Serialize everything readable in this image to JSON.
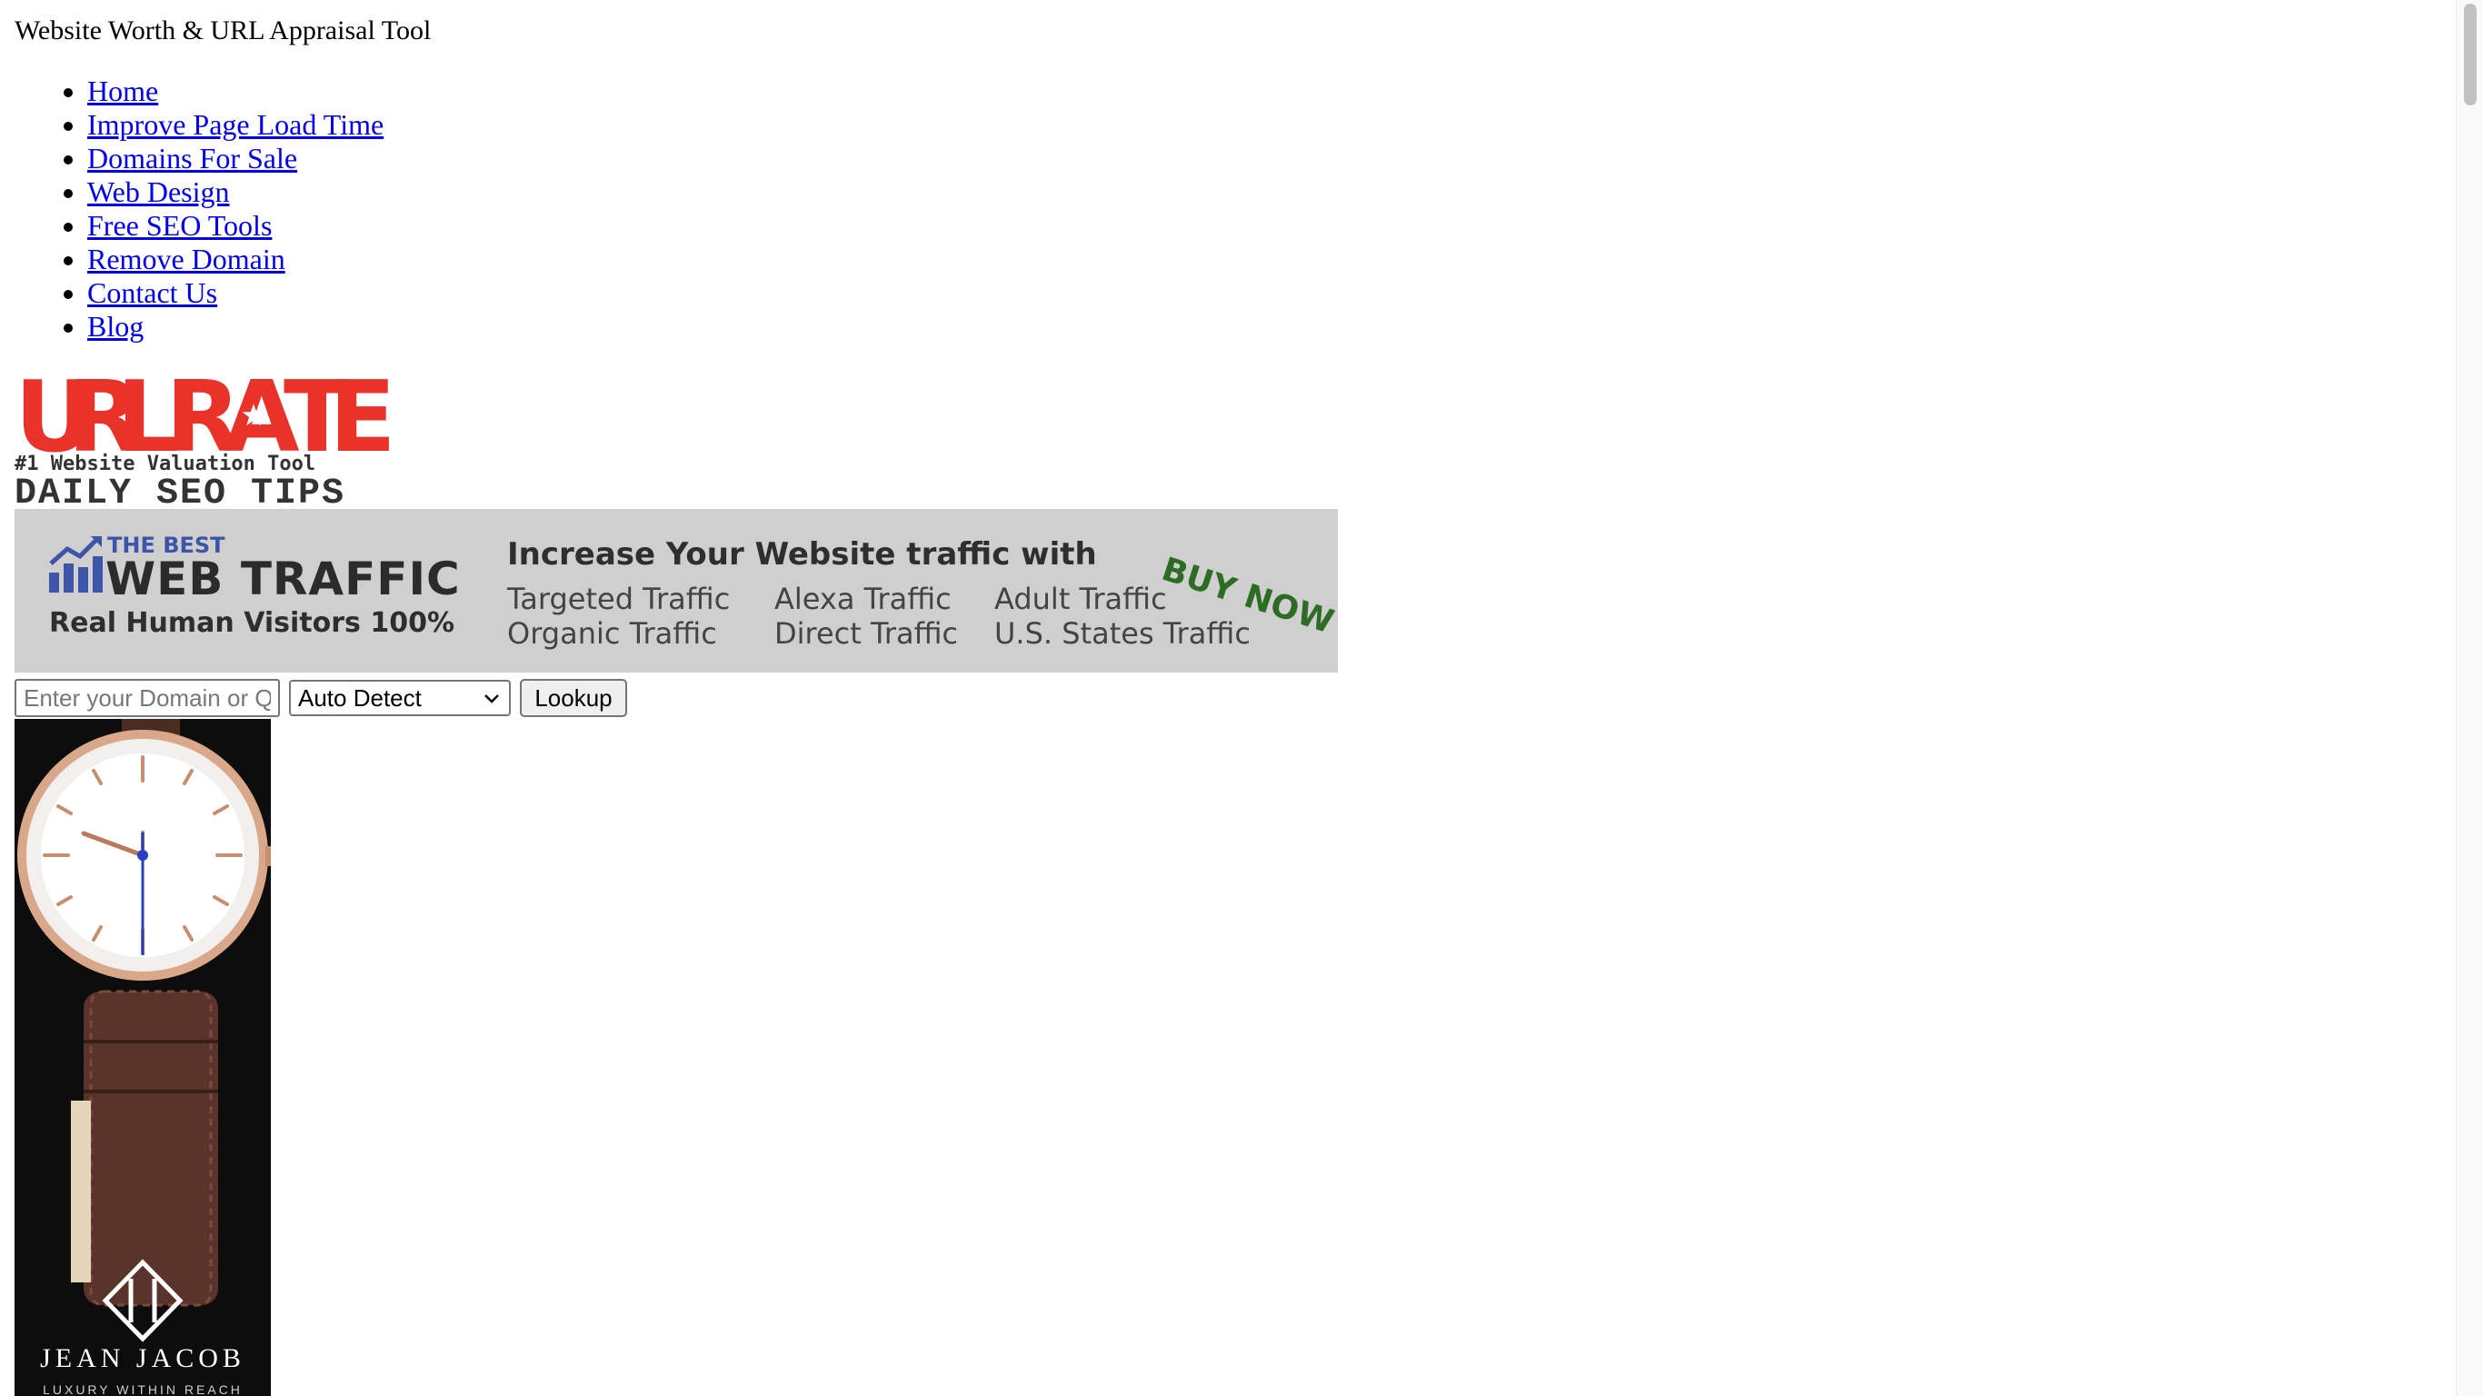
{
  "header": {
    "site_title": "Website Worth & URL Appraisal Tool"
  },
  "nav": [
    {
      "label": "Home"
    },
    {
      "label": "Improve Page Load Time"
    },
    {
      "label": "Domains For Sale"
    },
    {
      "label": "Web Design"
    },
    {
      "label": "Free SEO Tools"
    },
    {
      "label": "Remove Domain"
    },
    {
      "label": "Contact Us"
    },
    {
      "label": "Blog"
    }
  ],
  "logo": {
    "wordmark": "URLRATE",
    "tagline": "#1 Website Valuation Tool",
    "subtitle": "DAILY SEO TIPS",
    "color": "#e8322a"
  },
  "banner": {
    "kicker": "THE BEST",
    "title": "WEB TRAFFIC",
    "subtitle": "Real Human Visitors 100%",
    "headline": "Increase Your Website traffic with",
    "items": [
      "Targeted Traffic",
      "Alexa Traffic",
      "Adult Traffic",
      "Organic Traffic",
      "Direct Traffic",
      "U.S. States Traffic"
    ],
    "cta": "BUY NOW",
    "background": "#cfcfcf",
    "accent": "#3d55a8",
    "cta_color": "#2e6b24"
  },
  "search": {
    "placeholder": "Enter your Domain or Q",
    "select_value": "Auto Detect",
    "button_label": "Lookup"
  },
  "ad": {
    "brand": "JEAN JACOB",
    "slogan": "LUXURY WITHIN REACH"
  },
  "icons": {
    "chart": "bar-chart-trend-icon",
    "star": "star-icon",
    "dropdown": "chevron-down-icon",
    "brand_mark": "jean-jacob-logo-icon"
  }
}
